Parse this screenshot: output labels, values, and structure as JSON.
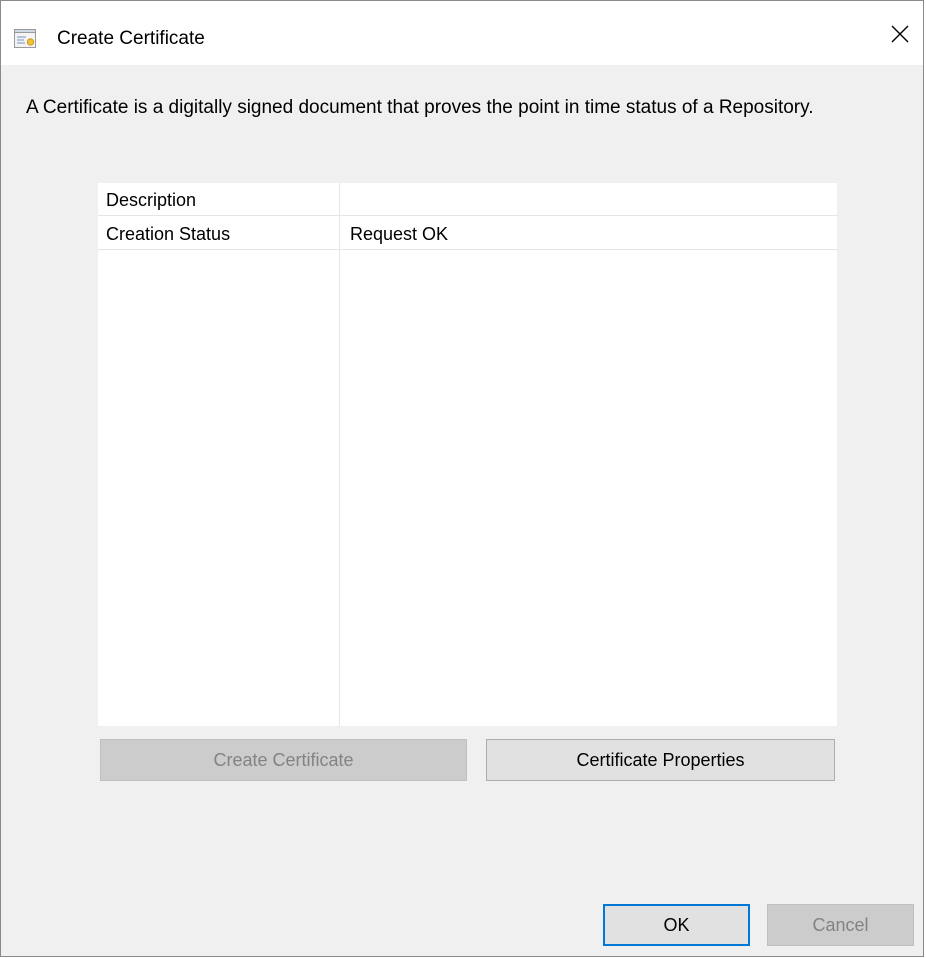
{
  "window": {
    "title": "Create Certificate",
    "title_icon": "certificate-icon",
    "close_icon": "close-icon"
  },
  "intro": "A Certificate is a digitally signed document that proves the point in time status of a Repository.",
  "properties": [
    {
      "key": "Description",
      "value": ""
    },
    {
      "key": "Creation Status",
      "value": "Request OK"
    }
  ],
  "actions": {
    "create_certificate": "Create Certificate",
    "certificate_properties": "Certificate Properties"
  },
  "dialog_buttons": {
    "ok": "OK",
    "cancel": "Cancel"
  },
  "colors": {
    "window_bg": "#f0f0f0",
    "title_bg": "#ffffff",
    "focus_border": "#0078d7",
    "disabled_text": "#838383"
  }
}
